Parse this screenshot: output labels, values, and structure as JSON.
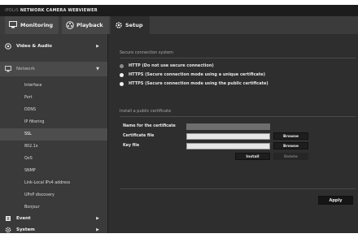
{
  "app": {
    "brand_prefix": "iPOLiS",
    "brand_title": "NETWORK CAMERA WEBVIEWER"
  },
  "topnav": {
    "monitoring": "Monitoring",
    "playback": "Playback",
    "setup": "Setup"
  },
  "sidebar": {
    "video_audio": "Video & Audio",
    "network": "Network",
    "network_items": [
      "Interface",
      "Port",
      "DDNS",
      "IP filtering",
      "SSL",
      "802.1x",
      "QoS",
      "SNMP",
      "Link-Local IPv4 address",
      "UPnP discovery",
      "Bonjour"
    ],
    "selected_item": "SSL",
    "event": "Event",
    "system": "System"
  },
  "main": {
    "secure_title": "Secure connection system",
    "options": [
      {
        "label": "HTTP (Do not use secure connection)",
        "selected": false
      },
      {
        "label": "HTTPS (Secure connection mode using a unique certificate)",
        "selected": true
      },
      {
        "label": "HTTPS (Secure connection mode using the public certificate)",
        "selected": true
      }
    ],
    "install_title": "Install a public certificate",
    "cert_name_label": "Name for the certificate",
    "cert_file_label": "Certificate file",
    "key_file_label": "Key file",
    "browse_label": "Browse",
    "install_label": "Install",
    "delete_label": "Delete",
    "apply_label": "Apply"
  },
  "colors": {
    "background": "#2e2e2e",
    "sidebar": "#3a3a3a",
    "button": "#1e1e1e",
    "input": "#e6e6e6"
  }
}
